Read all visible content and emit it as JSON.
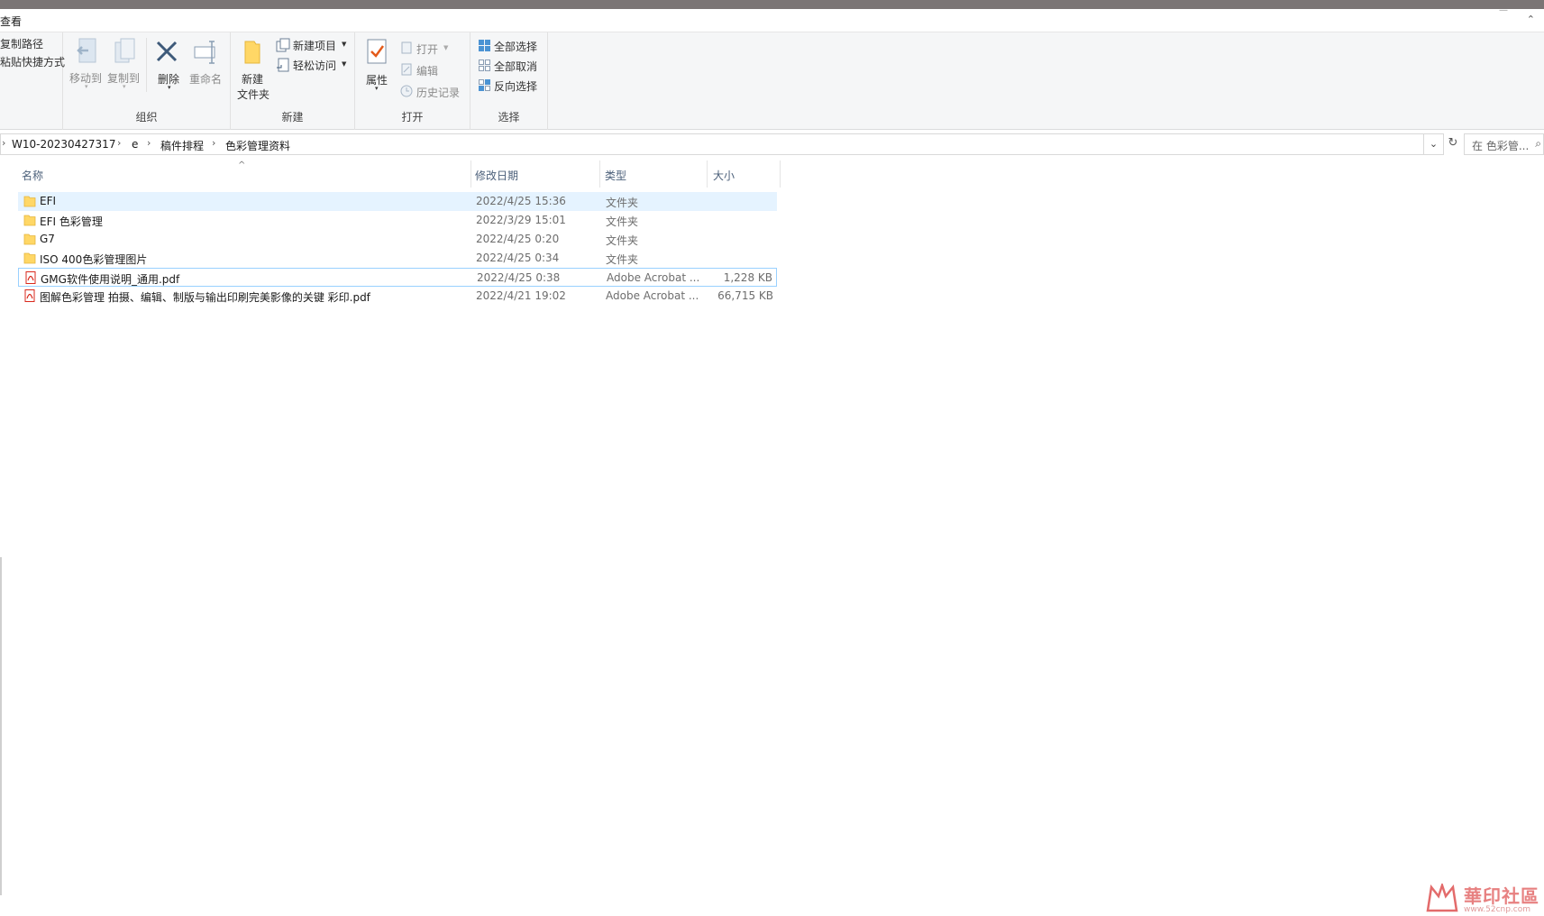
{
  "tab": {
    "label": "查看"
  },
  "ribbon": {
    "clipboard": {
      "copy_path": "复制路径",
      "paste_shortcut": "粘贴快捷方式"
    },
    "organize": {
      "move_to": "移动到",
      "copy_to": "复制到",
      "delete": "删除",
      "rename": "重命名",
      "label": "组织"
    },
    "new": {
      "new_folder_line1": "新建",
      "new_folder_line2": "文件夹",
      "new_item": "新建项目",
      "easy_access": "轻松访问",
      "label": "新建"
    },
    "open": {
      "properties": "属性",
      "open": "打开",
      "edit": "编辑",
      "history": "历史记录",
      "label": "打开"
    },
    "select": {
      "select_all": "全部选择",
      "select_none": "全部取消",
      "invert": "反向选择",
      "label": "选择"
    }
  },
  "address": {
    "crumbs": [
      "W10-20230427317",
      "e",
      "稿件排程",
      "色彩管理资料"
    ],
    "search_placeholder": "在 色彩管..."
  },
  "columns": {
    "name": "名称",
    "date": "修改日期",
    "type": "类型",
    "size": "大小"
  },
  "files": [
    {
      "name": "EFI",
      "date": "2022/4/25 15:36",
      "type": "文件夹",
      "size": "",
      "kind": "folder"
    },
    {
      "name": "EFI 色彩管理",
      "date": "2022/3/29 15:01",
      "type": "文件夹",
      "size": "",
      "kind": "folder"
    },
    {
      "name": "G7",
      "date": "2022/4/25 0:20",
      "type": "文件夹",
      "size": "",
      "kind": "folder"
    },
    {
      "name": "ISO 400色彩管理图片",
      "date": "2022/4/25 0:34",
      "type": "文件夹",
      "size": "",
      "kind": "folder"
    },
    {
      "name": "GMG软件使用说明_通用.pdf",
      "date": "2022/4/25 0:38",
      "type": "Adobe Acrobat ...",
      "size": "1,228 KB",
      "kind": "pdf"
    },
    {
      "name": "图解色彩管理  拍摄、编辑、制版与输出印刷完美影像的关键  彩印.pdf",
      "date": "2022/4/21 19:02",
      "type": "Adobe Acrobat ...",
      "size": "66,715 KB",
      "kind": "pdf"
    }
  ],
  "watermark": {
    "text": "華印社區",
    "url": "www.52cnp.com"
  },
  "colors": {
    "folder": "#ffd766",
    "pdf": "#d9291c",
    "selection": "#e5f3ff",
    "accent": "#1979ca"
  }
}
